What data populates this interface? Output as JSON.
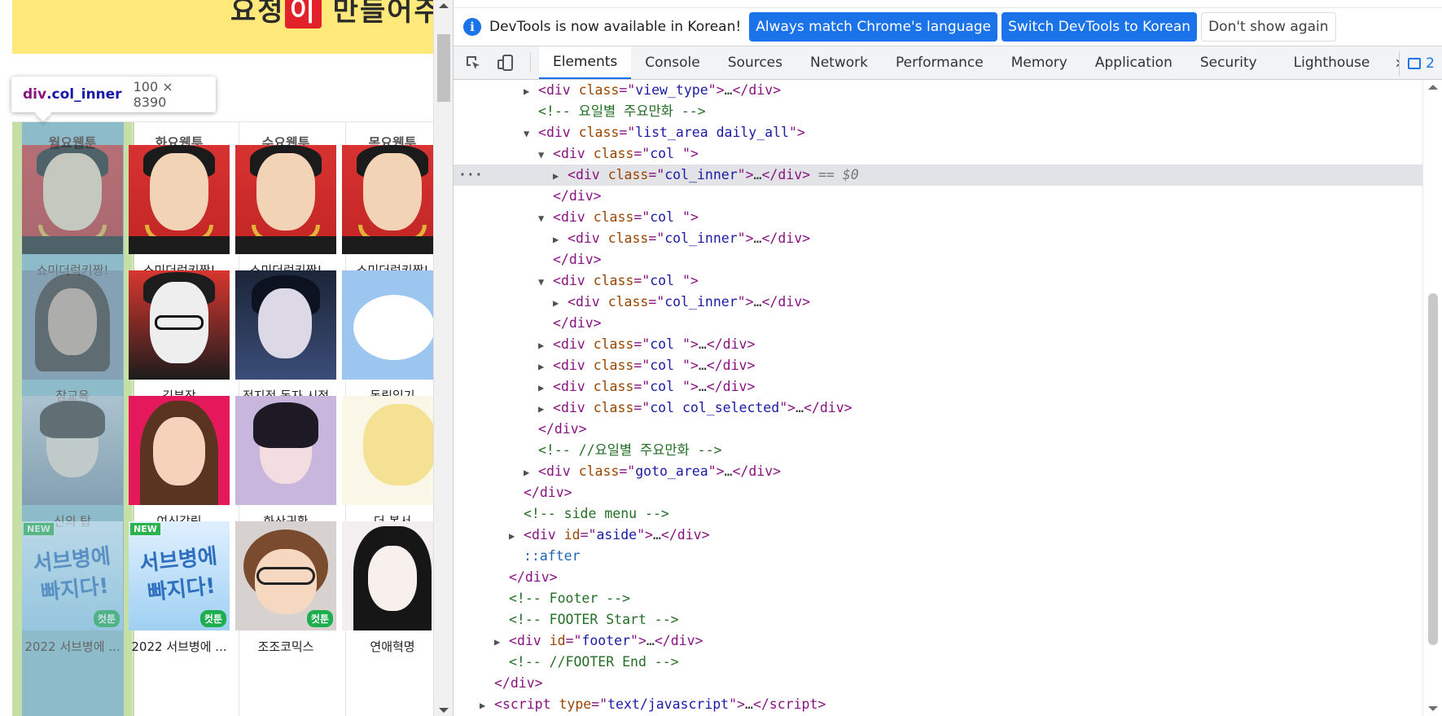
{
  "page": {
    "tooltip": {
      "tag": "div",
      "class": ".col_inner",
      "size": "100 × 8390"
    },
    "columns": [
      {
        "header": "월요웹툰",
        "items": [
          "쇼미더럭키짱!",
          "참교육",
          "신의 탑",
          "2022 서브병에 ..."
        ]
      },
      {
        "header": "화요웹툰",
        "items": [
          "쇼미더럭키짱!",
          "김부장",
          "여신강림",
          "2022 서브병에 ..."
        ]
      },
      {
        "header": "수요웹툰",
        "items": [
          "쇼미더럭키짱!",
          "전지적 독자 시점",
          "화산귀환",
          "조조코믹스"
        ]
      },
      {
        "header": "목요웹툰",
        "items": [
          "쇼미더럭키짱!",
          "독립일기",
          "더 복서",
          "연애혁명"
        ]
      }
    ],
    "badges": {
      "new": "NEW",
      "cut": "컷툰",
      "thumb_text": "서브병에 빠지다!"
    }
  },
  "devtools": {
    "infobar": {
      "icon": "info-icon",
      "message": "DevTools is now available in Korean!",
      "btn_match": "Always match Chrome's language",
      "btn_switch": "Switch DevTools to Korean",
      "btn_dismiss": "Don't show again"
    },
    "tabs": [
      "Elements",
      "Console",
      "Sources",
      "Network",
      "Performance",
      "Memory",
      "Application",
      "Security",
      "Lighthouse"
    ],
    "more_tabs": "»",
    "issues_count": "2",
    "colors": {
      "accent": "#1a73e8",
      "tag": "#881280",
      "attr": "#994500",
      "value": "#1a1aa6",
      "comment": "#236e25"
    },
    "dom": {
      "l0": {
        "tag": "div",
        "attr": "class",
        "val": "view_type"
      },
      "l1": "<!-- 요일별 주요만화 -->",
      "l2": {
        "tag": "div",
        "attr": "class",
        "val": "list_area daily_all"
      },
      "l3": {
        "tag": "div",
        "attr": "class",
        "val": "col "
      },
      "l4": {
        "tag": "div",
        "attr": "class",
        "val": "col_inner",
        "eq": "== $0"
      },
      "l5": "</div>",
      "l6": {
        "tag": "div",
        "attr": "class",
        "val": "col "
      },
      "l7": {
        "tag": "div",
        "attr": "class",
        "val": "col_inner"
      },
      "l8": "</div>",
      "l9": {
        "tag": "div",
        "attr": "class",
        "val": "col "
      },
      "l10": {
        "tag": "div",
        "attr": "class",
        "val": "col_inner"
      },
      "l11": "</div>",
      "l12": {
        "tag": "div",
        "attr": "class",
        "val": "col "
      },
      "l13": {
        "tag": "div",
        "attr": "class",
        "val": "col "
      },
      "l14": {
        "tag": "div",
        "attr": "class",
        "val": "col "
      },
      "l15": {
        "tag": "div",
        "attr": "class",
        "val": "col col_selected"
      },
      "l16": "</div>",
      "l17": "<!-- //요일별 주요만화 -->",
      "l18": {
        "tag": "div",
        "attr": "class",
        "val": "goto_area"
      },
      "l19": "</div>",
      "l20": "<!-- side menu -->",
      "l21": {
        "tag": "div",
        "attr": "id",
        "val": "aside"
      },
      "l22": "::after",
      "l23": "</div>",
      "l24": "<!-- Footer -->",
      "l25": "<!-- FOOTER Start -->",
      "l26": {
        "tag": "div",
        "attr": "id",
        "val": "footer"
      },
      "l27": "<!-- //FOOTER End -->",
      "l28": "</div>",
      "l29": {
        "tag": "script",
        "attr": "type",
        "val": "text/javascript"
      }
    }
  }
}
